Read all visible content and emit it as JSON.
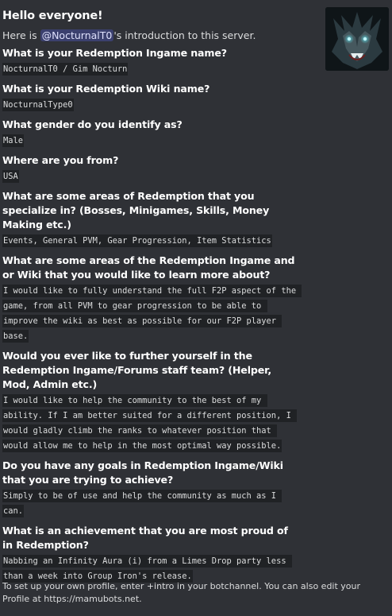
{
  "embed": {
    "title": "Hello everyone!",
    "description_prefix": "Here is ",
    "mention": "@NocturnalT0",
    "description_suffix": "'s introduction to this server.",
    "footer": "To set up your own profile, enter +intro in your botchannel. You can also edit your Profile at https://mamubots.net.",
    "thumbnail_icon": "wolf-avatar-icon",
    "accent_mention_bg": "#414675"
  },
  "fields": [
    {
      "name": "What is your Redemption Ingame name?",
      "value": "NocturnalT0 / Gim Nocturn"
    },
    {
      "name": "What is your Redemption Wiki name?",
      "value": "NocturnalType0"
    },
    {
      "name": "What gender do you identify as?",
      "value": "Male"
    },
    {
      "name": "Where are you from?",
      "value": "USA"
    },
    {
      "name": "What are some areas of Redemption that you specialize in? (Bosses, Minigames, Skills, Money Making etc.)",
      "value": "Events, General PVM, Gear Progression, Item Statistics"
    },
    {
      "name": "What are some areas of the Redemption Ingame and or Wiki that you would like to learn more about?",
      "value": "I would like to fully understand the full F2P aspect of the game, from all PVM to gear progression to be able to improve the wiki as best as possible for our F2P player base."
    },
    {
      "name": "Would you ever like to further yourself in the Redemption Ingame/Forums staff team? (Helper, Mod, Admin etc.)",
      "value": "I would like to help the community to the best of my ability. If I am better suited for a different position, I would gladly climb the ranks to whatever position that would allow me to help in the most optimal way possible."
    },
    {
      "name": "Do you have any goals in Redemption Ingame/Wiki that you are trying to achieve?",
      "value": "Simply to be of use and help the community as much as I can."
    },
    {
      "name": "What is an achievement that you are most proud of in Redemption?",
      "value": "Nabbing an Infinity Aura (i) from a Limes Drop party less than a week into Group Iron's release."
    }
  ]
}
